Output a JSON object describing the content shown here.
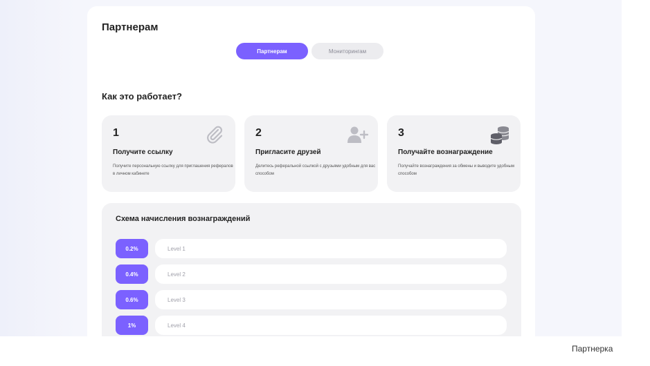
{
  "page": {
    "title": "Партнерам"
  },
  "tabs": [
    {
      "label": "Партнерам",
      "active": true
    },
    {
      "label": "Мониторингам",
      "active": false
    }
  ],
  "how_it_works": {
    "title": "Как это работает?",
    "steps": [
      {
        "number": "1",
        "title": "Получите ссылку",
        "description": "Получите персональную ссылку для приглашения рефералов в личном кабинете",
        "icon": "paperclip-icon"
      },
      {
        "number": "2",
        "title": "Пригласите друзей",
        "description": "Делитесь реферальной ссылкой с друзьями удобным для вас способом",
        "icon": "add-user-icon"
      },
      {
        "number": "3",
        "title": "Получайте вознаграждение",
        "description": "Получайте вознаграждения за обмены и выводите удобным способом",
        "icon": "coins-icon"
      }
    ]
  },
  "scheme": {
    "title": "Схема начисления вознаграждений",
    "levels": [
      {
        "percent": "0.2%",
        "label": "Level 1"
      },
      {
        "percent": "0.4%",
        "label": "Level 2"
      },
      {
        "percent": "0.6%",
        "label": "Level 3"
      },
      {
        "percent": "1%",
        "label": "Level 4"
      }
    ]
  },
  "caption": "Партнерка",
  "colors": {
    "accent": "#7b61ff",
    "card_bg": "#f2f2f4",
    "page_bg": "#f5f6fc"
  }
}
